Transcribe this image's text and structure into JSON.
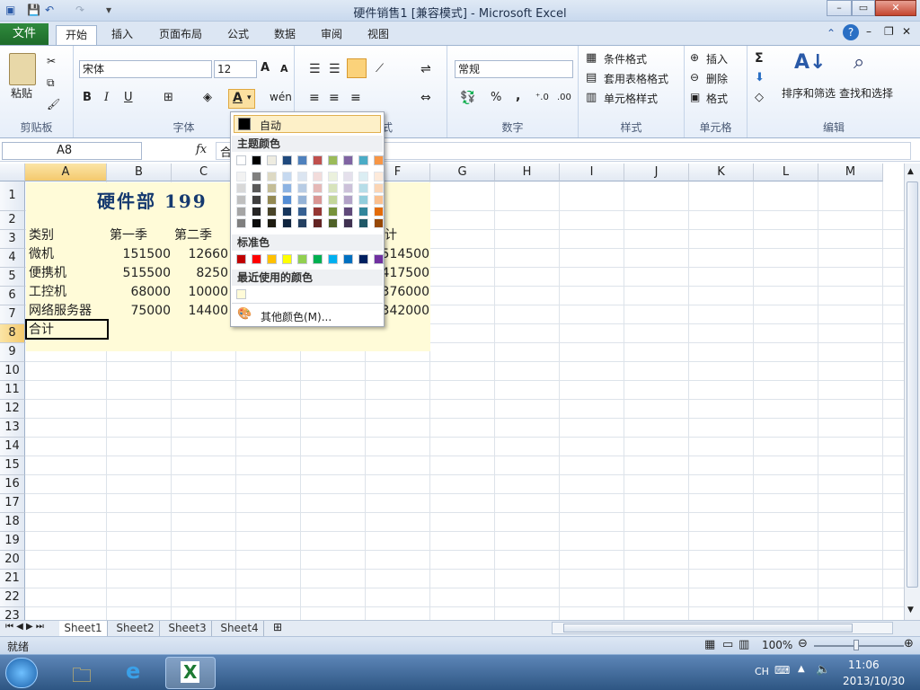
{
  "window": {
    "title": "硬件销售1  [兼容模式]  -  Microsoft Excel",
    "minimize": "–",
    "maximize": "▭",
    "close": "✕"
  },
  "tabs": {
    "file": "文件",
    "items": [
      "开始",
      "插入",
      "页面布局",
      "公式",
      "数据",
      "审阅",
      "视图"
    ]
  },
  "ribbon": {
    "clipboard": {
      "paste": "粘贴",
      "label": "剪贴板"
    },
    "font": {
      "name": "宋体",
      "size": "12",
      "bold": "B",
      "italic": "I",
      "underline": "U",
      "label": "字体"
    },
    "alignment": {
      "label": "对齐方式"
    },
    "number": {
      "format": "常规",
      "percent": "%",
      "comma": ",",
      "label": "数字"
    },
    "styles": {
      "conditional": "条件格式",
      "table": "套用表格格式",
      "cell": "单元格样式",
      "label": "样式"
    },
    "cells": {
      "insert": "插入",
      "delete": "删除",
      "format": "格式",
      "label": "单元格"
    },
    "editing": {
      "sort": "排序和筛选",
      "find": "查找和选择",
      "sum": "Σ",
      "label": "编辑"
    }
  },
  "formula_bar": {
    "name_box": "A8",
    "fx": "fx",
    "value": "合"
  },
  "grid": {
    "columns": [
      "A",
      "B",
      "C",
      "D",
      "E",
      "F",
      "G",
      "H",
      "I",
      "J",
      "K",
      "L",
      "M"
    ],
    "rows": [
      "1",
      "2",
      "3",
      "4",
      "5",
      "6",
      "7",
      "8",
      "9",
      "10",
      "11",
      "12",
      "13",
      "14",
      "15",
      "16",
      "17",
      "18",
      "19",
      "20",
      "21",
      "22",
      "23"
    ],
    "title": "硬件部  199",
    "headers": [
      "类别",
      "第一季",
      "第二季",
      "计"
    ],
    "data": [
      {
        "cat": "微机",
        "q1": "151500",
        "q2": "12660",
        "total": "514500"
      },
      {
        "cat": "便携机",
        "q1": "515500",
        "q2": "8250",
        "total": "417500"
      },
      {
        "cat": "工控机",
        "q1": "68000",
        "q2": "10000",
        "total": "376000"
      },
      {
        "cat": "网络服务器",
        "q1": "75000",
        "q2": "14400",
        "total": "342000"
      }
    ],
    "total_label": "合计"
  },
  "sheets": [
    "Sheet1",
    "Sheet2",
    "Sheet3",
    "Sheet4"
  ],
  "status": {
    "ready": "就绪",
    "zoom": "100%"
  },
  "color_picker": {
    "auto": "自动",
    "theme_header": "主题颜色",
    "standard_header": "标准色",
    "recent_header": "最近使用的颜色",
    "more": "其他颜色(M)...",
    "theme_top": [
      "#ffffff",
      "#000000",
      "#eeece1",
      "#1f497d",
      "#4f81bd",
      "#c0504d",
      "#9bbb59",
      "#8064a2",
      "#4bacc6",
      "#f79646"
    ],
    "theme_shades": [
      [
        "#f2f2f2",
        "#d8d8d8",
        "#bfbfbf",
        "#a5a5a5",
        "#7f7f7f"
      ],
      [
        "#7f7f7f",
        "#595959",
        "#3f3f3f",
        "#262626",
        "#0c0c0c"
      ],
      [
        "#ddd9c3",
        "#c4bd97",
        "#938953",
        "#494429",
        "#1d1b10"
      ],
      [
        "#c6d9f0",
        "#8db3e2",
        "#548dd4",
        "#17365d",
        "#0f243e"
      ],
      [
        "#dbe5f1",
        "#b8cce4",
        "#95b3d7",
        "#366092",
        "#244061"
      ],
      [
        "#f2dcdb",
        "#e5b9b7",
        "#d99694",
        "#953734",
        "#632423"
      ],
      [
        "#ebf1dd",
        "#d7e3bc",
        "#c3d69b",
        "#76923c",
        "#4f6128"
      ],
      [
        "#e5e0ec",
        "#ccc1d9",
        "#b2a2c7",
        "#5f497a",
        "#3f3151"
      ],
      [
        "#dbeef3",
        "#b7dde8",
        "#92cddc",
        "#31859b",
        "#205867"
      ],
      [
        "#fdeada",
        "#fbd5b5",
        "#fac08f",
        "#e36c09",
        "#974806"
      ]
    ],
    "standard": [
      "#c00000",
      "#ff0000",
      "#ffc000",
      "#ffff00",
      "#92d050",
      "#00b050",
      "#00b0f0",
      "#0070c0",
      "#002060",
      "#7030a0"
    ],
    "recent": [
      "#fffbd8"
    ]
  },
  "taskbar": {
    "lang": "CH",
    "time": "11:06",
    "date": "2013/10/30"
  }
}
